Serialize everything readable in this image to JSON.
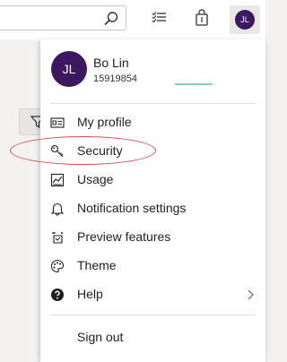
{
  "user": {
    "initials": "JL",
    "name": "Bo Lin",
    "phone": "15919854"
  },
  "menu": {
    "items": [
      {
        "label": "My profile",
        "icon": "profile-card-icon"
      },
      {
        "label": "Security",
        "icon": "key-icon"
      },
      {
        "label": "Usage",
        "icon": "usage-icon"
      },
      {
        "label": "Notification settings",
        "icon": "bell-icon"
      },
      {
        "label": "Preview features",
        "icon": "preview-icon"
      },
      {
        "label": "Theme",
        "icon": "palette-icon"
      },
      {
        "label": "Help",
        "icon": "help-icon"
      }
    ],
    "sign_out": "Sign out"
  },
  "colors": {
    "avatar_bg": "#3b1860",
    "highlight": "#e0484b"
  }
}
